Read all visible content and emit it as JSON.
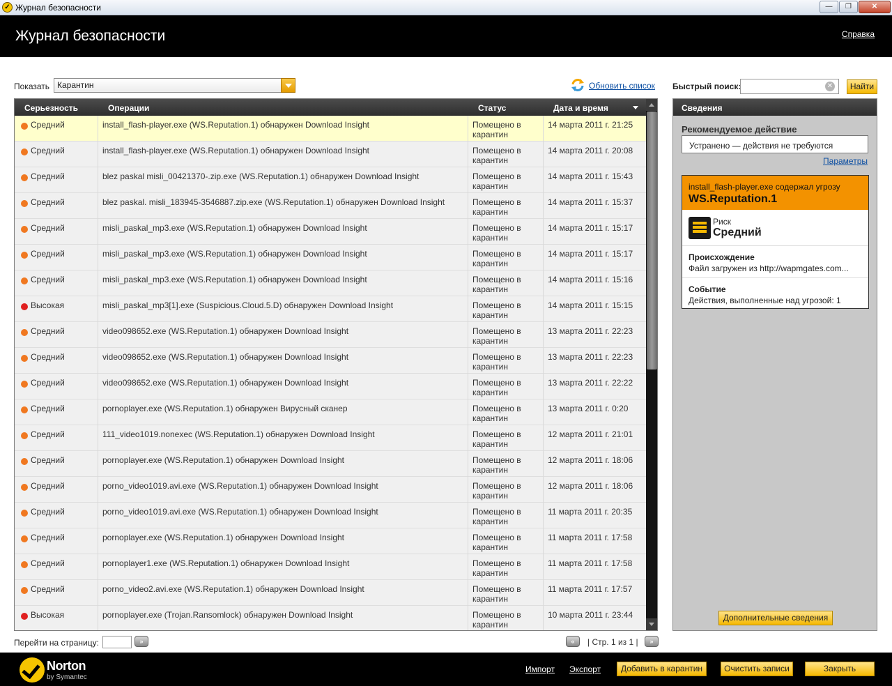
{
  "window": {
    "title": "Журнал безопасности",
    "app_icon": "norton-shield-icon"
  },
  "header": {
    "title": "Журнал безопасности",
    "help_link": "Справка"
  },
  "filter": {
    "label": "Показать",
    "selected": "Карантин"
  },
  "refresh": {
    "label": "Обновить список",
    "icon": "refresh-icon"
  },
  "quick_search": {
    "label": "Быстрый поиск:",
    "value": "",
    "button": "Найти"
  },
  "table": {
    "headers": [
      "Серьезность",
      "Операции",
      "Статус",
      "Дата и время"
    ],
    "colors": {
      "medium": "#f07820",
      "high": "#e02020"
    },
    "rows": [
      {
        "severity": "Средний",
        "level": "medium",
        "operation": "install_flash-player.exe (WS.Reputation.1) обнаружен Download Insight",
        "status": "Помещено в карантин",
        "date": "14 марта 2011 г. 21:25",
        "selected": true
      },
      {
        "severity": "Средний",
        "level": "medium",
        "operation": "install_flash-player.exe (WS.Reputation.1) обнаружен Download Insight",
        "status": "Помещено в карантин",
        "date": "14 марта 2011 г. 20:08"
      },
      {
        "severity": "Средний",
        "level": "medium",
        "operation": "blez paskal misli_00421370-.zip.exe (WS.Reputation.1) обнаружен Download Insight",
        "status": "Помещено в карантин",
        "date": "14 марта 2011 г. 15:43"
      },
      {
        "severity": "Средний",
        "level": "medium",
        "operation": "blez paskal. misli_183945-3546887.zip.exe (WS.Reputation.1) обнаружен Download Insight",
        "status": "Помещено в карантин",
        "date": "14 марта 2011 г. 15:37"
      },
      {
        "severity": "Средний",
        "level": "medium",
        "operation": "misli_paskal_mp3.exe (WS.Reputation.1) обнаружен Download Insight",
        "status": "Помещено в карантин",
        "date": "14 марта 2011 г. 15:17"
      },
      {
        "severity": "Средний",
        "level": "medium",
        "operation": "misli_paskal_mp3.exe (WS.Reputation.1) обнаружен Download Insight",
        "status": "Помещено в карантин",
        "date": "14 марта 2011 г. 15:17"
      },
      {
        "severity": "Средний",
        "level": "medium",
        "operation": "misli_paskal_mp3.exe (WS.Reputation.1) обнаружен Download Insight",
        "status": "Помещено в карантин",
        "date": "14 марта 2011 г. 15:16"
      },
      {
        "severity": "Высокая",
        "level": "high",
        "operation": "misli_paskal_mp3[1].exe (Suspicious.Cloud.5.D) обнаружен Download Insight",
        "status": "Помещено в карантин",
        "date": "14 марта 2011 г. 15:15"
      },
      {
        "severity": "Средний",
        "level": "medium",
        "operation": "video098652.exe (WS.Reputation.1) обнаружен Download Insight",
        "status": "Помещено в карантин",
        "date": "13 марта 2011 г. 22:23"
      },
      {
        "severity": "Средний",
        "level": "medium",
        "operation": "video098652.exe (WS.Reputation.1) обнаружен Download Insight",
        "status": "Помещено в карантин",
        "date": "13 марта 2011 г. 22:23"
      },
      {
        "severity": "Средний",
        "level": "medium",
        "operation": "video098652.exe (WS.Reputation.1) обнаружен Download Insight",
        "status": "Помещено в карантин",
        "date": "13 марта 2011 г. 22:22"
      },
      {
        "severity": "Средний",
        "level": "medium",
        "operation": "pornoplayer.exe (WS.Reputation.1) обнаружен Вирусный сканер",
        "status": "Помещено в карантин",
        "date": "13 марта 2011 г. 0:20"
      },
      {
        "severity": "Средний",
        "level": "medium",
        "operation": "111_video1019.nonexec (WS.Reputation.1) обнаружен Download Insight",
        "status": "Помещено в карантин",
        "date": "12 марта 2011 г. 21:01"
      },
      {
        "severity": "Средний",
        "level": "medium",
        "operation": "pornoplayer.exe (WS.Reputation.1) обнаружен Download Insight",
        "status": "Помещено в карантин",
        "date": "12 марта 2011 г. 18:06"
      },
      {
        "severity": "Средний",
        "level": "medium",
        "operation": "porno_video1019.avi.exe (WS.Reputation.1) обнаружен Download Insight",
        "status": "Помещено в карантин",
        "date": "12 марта 2011 г. 18:06"
      },
      {
        "severity": "Средний",
        "level": "medium",
        "operation": "porno_video1019.avi.exe (WS.Reputation.1) обнаружен Download Insight",
        "status": "Помещено в карантин",
        "date": "11 марта 2011 г. 20:35"
      },
      {
        "severity": "Средний",
        "level": "medium",
        "operation": "pornoplayer.exe (WS.Reputation.1) обнаружен Download Insight",
        "status": "Помещено в карантин",
        "date": "11 марта 2011 г. 17:58"
      },
      {
        "severity": "Средний",
        "level": "medium",
        "operation": "pornoplayer1.exe (WS.Reputation.1) обнаружен Download Insight",
        "status": "Помещено в карантин",
        "date": "11 марта 2011 г. 17:58"
      },
      {
        "severity": "Средний",
        "level": "medium",
        "operation": "porno_video2.avi.exe (WS.Reputation.1) обнаружен Download Insight",
        "status": "Помещено в карантин",
        "date": "11 марта 2011 г. 17:57"
      },
      {
        "severity": "Высокая",
        "level": "high",
        "operation": "pornoplayer.exe (Trojan.Ransomlock) обнаружен Download Insight",
        "status": "Помещено в карантин",
        "date": "10 марта 2011 г. 23:44"
      }
    ]
  },
  "pagination": {
    "goto_label": "Перейти на страницу:",
    "goto_value": "",
    "page_info": "| Стр. 1 из 1 |"
  },
  "details": {
    "header": "Сведения",
    "recommended_title": "Рекомендуемое действие",
    "recommended_value": "Устранено — действия не требуются",
    "params_link": "Параметры",
    "threat_line": "install_flash-player.exe содержал угрозу",
    "threat_name": "WS.Reputation.1",
    "risk_label": "Риск",
    "risk_value": "Средний",
    "origin_label": "Происхождение",
    "origin_value": "Файл загружен из http://wapmgates.com...",
    "event_label": "Событие",
    "event_value": "Действия, выполненные над угрозой: 1",
    "more_button": "Дополнительные сведения",
    "accent_color": "#f39200"
  },
  "footer": {
    "brand": "Norton",
    "brand_sub": "by Symantec",
    "import_link": "Импорт",
    "export_link": "Экспорт",
    "add_quarantine": "Добавить в карантин",
    "clear_log": "Очистить записи",
    "close": "Закрыть"
  }
}
